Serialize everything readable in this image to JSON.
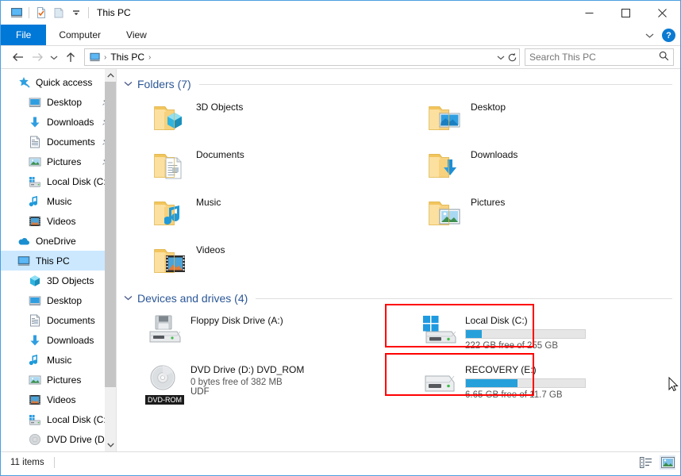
{
  "window": {
    "title": "This PC",
    "quick_access_icons": [
      "this-pc-icon",
      "properties-icon",
      "new-folder-icon",
      "customize-chevron-icon"
    ],
    "controls": {
      "minimize": "─",
      "maximize": "☐",
      "close": "✕"
    }
  },
  "ribbon": {
    "tabs": [
      {
        "label": "File",
        "active": true
      },
      {
        "label": "Computer",
        "active": false
      },
      {
        "label": "View",
        "active": false
      }
    ],
    "collapse_label": "ˇ",
    "help_label": "?"
  },
  "address": {
    "back": "←",
    "forward": "→",
    "recent": "ˇ",
    "up": "↑",
    "crumb_icon": "this-pc-icon",
    "crumb_text": "This PC",
    "sep": "›",
    "dropdown": "ˇ",
    "refresh": "↻"
  },
  "search": {
    "placeholder": "Search This PC",
    "value": "",
    "icon": "search-icon"
  },
  "sidebar": {
    "items": [
      {
        "label": "Quick access",
        "icon": "star-pin-icon",
        "indent": 0,
        "pinned": false,
        "selected": false
      },
      {
        "label": "Desktop",
        "icon": "desktop-icon",
        "indent": 1,
        "pinned": true,
        "selected": false
      },
      {
        "label": "Downloads",
        "icon": "downloads-icon",
        "indent": 1,
        "pinned": true,
        "selected": false
      },
      {
        "label": "Documents",
        "icon": "documents-icon",
        "indent": 1,
        "pinned": true,
        "selected": false
      },
      {
        "label": "Pictures",
        "icon": "pictures-icon",
        "indent": 1,
        "pinned": true,
        "selected": false
      },
      {
        "label": "Local Disk (C:)",
        "icon": "drive-icon",
        "indent": 1,
        "pinned": false,
        "selected": false
      },
      {
        "label": "Music",
        "icon": "music-icon",
        "indent": 1,
        "pinned": false,
        "selected": false
      },
      {
        "label": "Videos",
        "icon": "videos-icon",
        "indent": 1,
        "pinned": false,
        "selected": false
      },
      {
        "label": "OneDrive",
        "icon": "onedrive-cloud-icon",
        "indent": 0,
        "pinned": false,
        "selected": false
      },
      {
        "label": "This PC",
        "icon": "this-pc-icon",
        "indent": 0,
        "pinned": false,
        "selected": true
      },
      {
        "label": "3D Objects",
        "icon": "3d-objects-icon",
        "indent": 1,
        "pinned": false,
        "selected": false
      },
      {
        "label": "Desktop",
        "icon": "desktop-icon",
        "indent": 1,
        "pinned": false,
        "selected": false
      },
      {
        "label": "Documents",
        "icon": "documents-icon",
        "indent": 1,
        "pinned": false,
        "selected": false
      },
      {
        "label": "Downloads",
        "icon": "downloads-icon",
        "indent": 1,
        "pinned": false,
        "selected": false
      },
      {
        "label": "Music",
        "icon": "music-icon",
        "indent": 1,
        "pinned": false,
        "selected": false
      },
      {
        "label": "Pictures",
        "icon": "pictures-icon",
        "indent": 1,
        "pinned": false,
        "selected": false
      },
      {
        "label": "Videos",
        "icon": "videos-icon",
        "indent": 1,
        "pinned": false,
        "selected": false
      },
      {
        "label": "Local Disk (C:)",
        "icon": "drive-icon",
        "indent": 1,
        "pinned": false,
        "selected": false
      },
      {
        "label": "DVD Drive (D:) D",
        "icon": "dvd-icon",
        "indent": 1,
        "pinned": false,
        "selected": false
      }
    ],
    "scroll_up": "˄",
    "scroll_down": "˅"
  },
  "main": {
    "groups": [
      {
        "title": "Folders (7)",
        "chevron": "˅"
      },
      {
        "title": "Devices and drives (4)",
        "chevron": "˅"
      }
    ],
    "folders": [
      {
        "name": "3D Objects",
        "icon": "folder-3d-objects-icon"
      },
      {
        "name": "Desktop",
        "icon": "folder-desktop-icon"
      },
      {
        "name": "Documents",
        "icon": "folder-documents-icon"
      },
      {
        "name": "Downloads",
        "icon": "folder-downloads-icon"
      },
      {
        "name": "Music",
        "icon": "folder-music-icon"
      },
      {
        "name": "Pictures",
        "icon": "folder-pictures-icon"
      },
      {
        "name": "Videos",
        "icon": "folder-videos-icon"
      }
    ],
    "drives": [
      {
        "name": "Floppy Disk Drive (A:)",
        "icon": "floppy-drive-icon",
        "has_bar": false,
        "free_text": "",
        "extra": "",
        "highlighted": false
      },
      {
        "name": "Local Disk (C:)",
        "icon": "windows-drive-icon",
        "has_bar": true,
        "bar_percent": 13,
        "bar_color": "#26a0da",
        "free_text": "222 GB free of 255 GB",
        "extra": "",
        "highlighted": true
      },
      {
        "name": "DVD Drive (D:) DVD_ROM",
        "icon": "dvd-drive-icon",
        "badge": "DVD-ROM",
        "has_bar": false,
        "free_text": "0 bytes free of 382 MB",
        "extra": "UDF",
        "highlighted": false
      },
      {
        "name": "RECOVERY (E:)",
        "icon": "drive-icon",
        "has_bar": true,
        "bar_percent": 43,
        "bar_color": "#26a0da",
        "free_text": "6.65 GB free of 11.7 GB",
        "extra": "",
        "highlighted": true
      }
    ]
  },
  "status": {
    "item_count": "11 items",
    "view_details_icon": "details-view-icon",
    "view_large_icon": "large-icons-view-icon"
  },
  "colors": {
    "accent": "#0078d7",
    "group_header": "#2b5797",
    "bar_blue": "#26a0da",
    "highlight_red": "#ff0000",
    "selection": "#cce8ff"
  }
}
